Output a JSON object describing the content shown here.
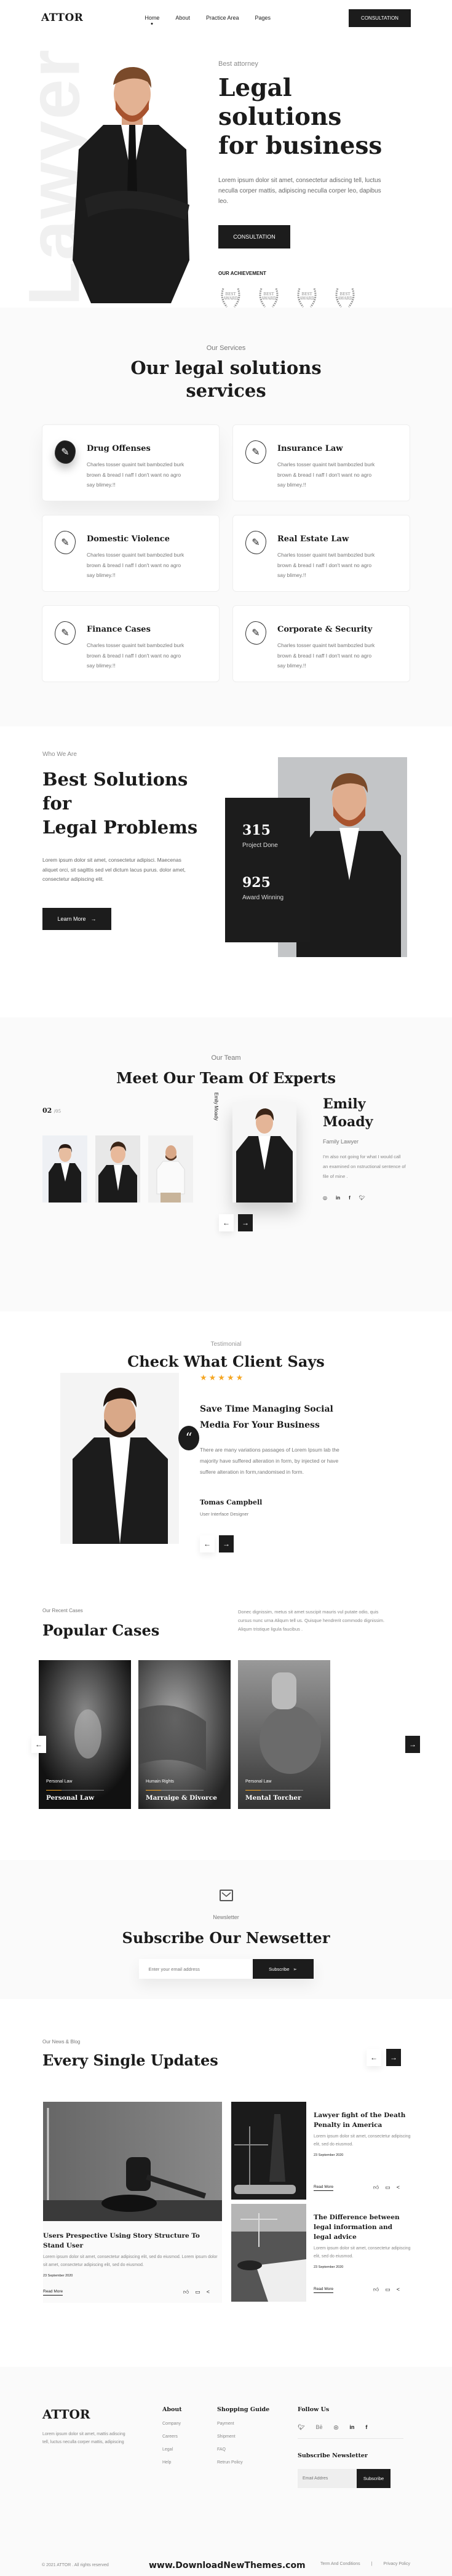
{
  "header": {
    "logo": "ATTOR",
    "nav": [
      "Home",
      "About",
      "Practice Area",
      "Pages"
    ],
    "active_nav": "Home",
    "cta": "CONSULTATION"
  },
  "hero": {
    "background_word": "Lawyer",
    "kicker": "Best attorney",
    "title_line1": "Legal solutions",
    "title_line2": "for business",
    "lead": "Lorem ipsum dolor sit amet, consectetur adiscing tell, luctus neculla corper mattis, adipiscing neculla corper leo, dapibus leo.",
    "cta": "CONSULTATION",
    "achievement_label": "OUR ACHIEVEMENT",
    "awards": [
      {
        "line1": "BEST",
        "line2": "AWARD"
      },
      {
        "line1": "BEST",
        "line2": "AWARD"
      },
      {
        "line1": "BEST",
        "line2": "AWARD"
      },
      {
        "line1": "BEST",
        "line2": "AWARD"
      }
    ]
  },
  "services": {
    "kicker": "Our Services",
    "title_line1": "Our legal solutions",
    "title_line2": "services",
    "items": [
      {
        "title": "Drug Offenses",
        "text": "Charles tosser quaint twit bambozled burk brown & bread I naff I don't want no agro say blimey.!!",
        "active": true
      },
      {
        "title": "Insurance Law",
        "text": "Charles tosser quaint twit bambozled burk brown & bread I naff I don't want no agro say blimey.!!",
        "active": false
      },
      {
        "title": "Domestic Violence",
        "text": "Charles tosser quaint twit bambozled burk brown & bread I naff I don't want no agro say blimey.!!",
        "active": false
      },
      {
        "title": "Real Estate Law",
        "text": "Charles tosser quaint twit bambozled burk brown & bread I naff I don't want no agro say blimey.!!",
        "active": false
      },
      {
        "title": "Finance Cases",
        "text": "Charles tosser quaint twit bambozled burk brown & bread I naff I don't want no agro say blimey.!!",
        "active": false
      },
      {
        "title": "Corporate & Security",
        "text": "Charles tosser quaint twit bambozled burk brown & bread I naff I don't want no agro say blimey.!!",
        "active": false
      }
    ]
  },
  "who": {
    "kicker": "Who We Are",
    "title_line1": "Best Solutions for",
    "title_line2": "Legal Problems",
    "text": "Lorem ipsum dolor sit amet, consectetur adipisci. Maecenas aliquet orci, sit sagittis sed vel dictum lacus purus. dolor amet, consectetur adipiscing elit.",
    "cta": "Learn More",
    "stats": [
      {
        "value": "315",
        "label": "Project Done"
      },
      {
        "value": "925",
        "label": "Award Winning"
      }
    ]
  },
  "team": {
    "kicker": "Our Team",
    "title": "Meet Our Team Of Experts",
    "current": "02",
    "total": "/05",
    "vertical_name": "Emily Moady",
    "name_line1": "Emily",
    "name_line2": "Moady",
    "role": "Family Lawyer",
    "bio": "I'm also not going for what I would call an examined on nstructional sentence  of file of mine .",
    "socials": [
      "instagram",
      "linkedin",
      "facebook",
      "twitter"
    ]
  },
  "testimonial": {
    "kicker": "Testimonial",
    "title": "Check What Client Says",
    "rating": 5,
    "stars": "★★★★★",
    "headline": "Save Time Managing Social Media For Your Business",
    "text": "There are many variations passages of Lorem Ipsum lab the majority have suffered alteration in form, by injected or have suffere alteration in form,randomised in form.",
    "name": "Tomas Campbell",
    "role": "User Interface Designer"
  },
  "cases": {
    "kicker": "Our Recent Cases",
    "title": "Popular Cases",
    "description": "Donec dignissim, metus sit amet suscipit mauris vul putate odio, quis cursus nunc urna Aliqum tell us. Quisque hendrerit commodo dignissim. Aliqum tristique ligula faucibus .",
    "items": [
      {
        "category": "Personal Law",
        "title": "Personal Law"
      },
      {
        "category": "Humain Rights",
        "title": "Marraige & Divorce"
      },
      {
        "category": "Personal Law",
        "title": "Mental Torcher"
      }
    ]
  },
  "newsletter": {
    "kicker": "Newsletter",
    "title": "Subscribe Our Newsetter",
    "placeholder": "Enter your email address",
    "button": "Subscribe"
  },
  "blog": {
    "kicker": "Our News & Blog",
    "title": "Every Single Updates",
    "read_more": "Read More",
    "posts": [
      {
        "title": "Users Prespective Using Story Structure To Stand User",
        "excerpt": "Lorem ipsum dolor sit amet, consectetur adipiscing elit, sed do eiusmod. Lorem ipsum dolor sit amet, consectetur adipiscing elit, sed do eiusmod.",
        "date": "23 September 2020"
      },
      {
        "title": "Lawyer fight of the Death Penalty in America",
        "excerpt": "Lorem ipsum dolor sit amet, consectetur adipiscing elit, sed do eiusmod.",
        "date": "23 September 2020"
      },
      {
        "title": "The Difference between legal information and legal advice",
        "excerpt": "Lorem ipsum dolor sit amet, consectetur adipiscing elit, sed do eiusmod.",
        "date": "23 September 2020"
      }
    ]
  },
  "footer": {
    "logo": "ATTOR",
    "about": "Lorem ipsum dolor sit amet, mattis adiscing tell, luctus neculla corper mattis, adipiscing",
    "col1": {
      "title": "About",
      "links": [
        "Company",
        "Careers",
        "Legal",
        "Help"
      ]
    },
    "col2": {
      "title": "Shopping Guide",
      "links": [
        "Payment",
        "Shipment",
        "FAQ",
        "Retrun Policy"
      ]
    },
    "follow_title": "Follow Us",
    "socials": [
      "twitter",
      "behance",
      "instagram",
      "linkedin",
      "facebook"
    ],
    "newsletter_title": "Subscribe Newsletter",
    "email_placeholder": "Email Addres",
    "subscribe": "Subscribe",
    "copyright": "© 2021 ATTOR . All rights reserved",
    "watermark": "www.DownloadNewThemes.com",
    "terms": "Term And Conditions",
    "privacy": "Privacy Policy"
  }
}
